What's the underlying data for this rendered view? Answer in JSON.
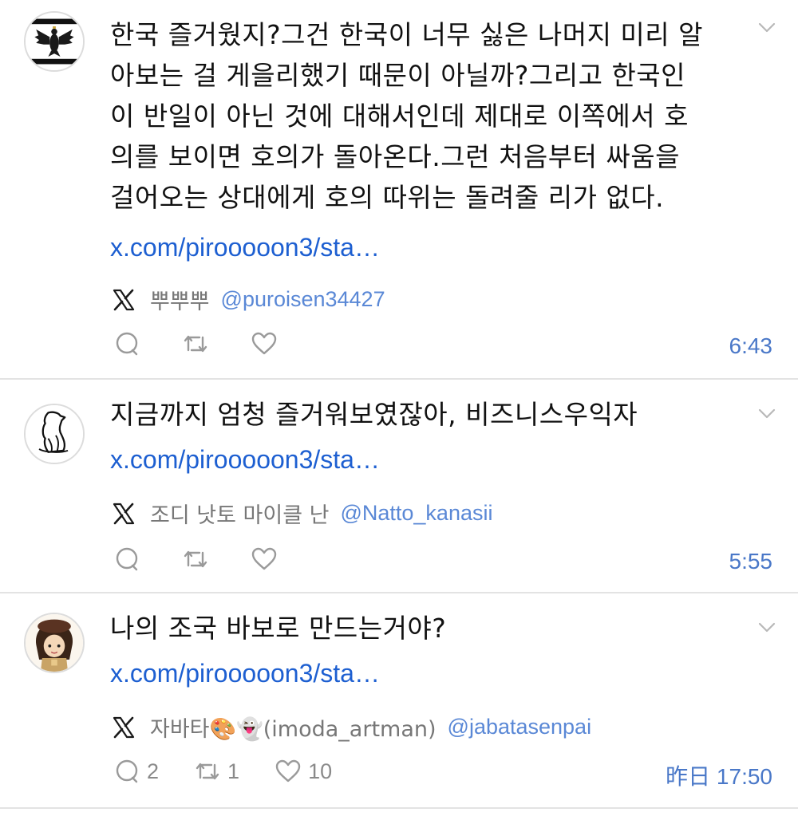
{
  "tweets": [
    {
      "text": "한국 즐거웠지?그건 한국이 너무 싫은 나머지 미리 알\n아보는 걸 게을리했기 때문이 아닐까?그리고 한국인\n이 반일이 아닌 것에 대해서인데 제대로 이쪽에서 호\n의를 보이면 호의가 돌아온다.그런 처음부터 싸움을\n걸어오는 상대에게 호의 따위는 돌려줄 리가 없다.",
      "link": "x.com/pirooooon3/sta…",
      "display_name": "뿌뿌뿌",
      "handle": "@puroisen34427",
      "replies": "",
      "retweets": "",
      "likes": "",
      "time": "6:43",
      "avatar": "prussian-eagle-flag-avatar"
    },
    {
      "text": "지금까지 엄청 즐거워보였잖아, 비즈니스우익자",
      "link": "x.com/pirooooon3/sta…",
      "display_name": "조디 낫토 마이클 난",
      "handle": "@Natto_kanasii",
      "replies": "",
      "retweets": "",
      "likes": "",
      "time": "5:55",
      "avatar": "sitting-animal-sketch-avatar"
    },
    {
      "text": "나의 조국 바보로 만드는거야?",
      "link": "x.com/pirooooon3/sta…",
      "display_name": "자바타🎨👻(imoda_artman)",
      "handle": "@jabatasenpai",
      "replies": "2",
      "retweets": "1",
      "likes": "10",
      "time": "昨日 17:50",
      "avatar": "cartoon-girl-avatar"
    }
  ],
  "icons": {
    "source": "x-logo-icon",
    "reply": "reply-icon",
    "retweet": "retweet-icon",
    "like": "heart-icon",
    "menu": "chevron-down-icon"
  },
  "colors": {
    "link": "#1d5fd1",
    "handle": "#5a88d6",
    "time": "#4a78c8",
    "muted": "#8a8a8a",
    "divider": "#e3e3e3"
  }
}
